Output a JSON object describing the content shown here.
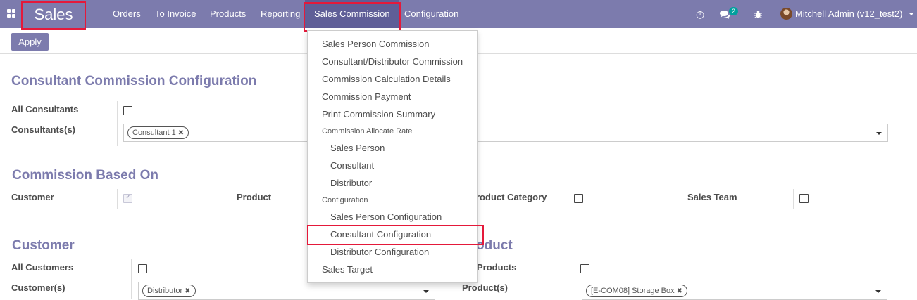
{
  "app": {
    "name": "Sales"
  },
  "topmenu": {
    "items": [
      "Orders",
      "To Invoice",
      "Products",
      "Reporting",
      "Sales Commission",
      "Configuration"
    ],
    "active": "Sales Commission"
  },
  "systray": {
    "messages_count": "2",
    "user": "Mitchell Admin (v12_test2)"
  },
  "control": {
    "apply_label": "Apply"
  },
  "consultant_section": {
    "title": "Consultant Commission Configuration",
    "all_label": "All Consultants",
    "list_label": "Consultants(s)",
    "tags": [
      "Consultant 1"
    ]
  },
  "based_on": {
    "title": "Commission Based On",
    "customer_label": "Customer",
    "customer_checked": true,
    "product_label": "Product",
    "product_category_label": "roduct Category",
    "sales_team_label": "Sales Team"
  },
  "customer_section": {
    "title": "Customer",
    "all_label": "All Customers",
    "list_label": "Customer(s)",
    "tags": [
      "Distributor"
    ]
  },
  "product_section": {
    "title": "oduct",
    "all_label": "Products",
    "list_label": "Product(s)",
    "tags": [
      "[E-COM08] Storage Box"
    ]
  },
  "dropdown": {
    "items": [
      {
        "type": "item",
        "label": "Sales Person Commission",
        "indent": false
      },
      {
        "type": "item",
        "label": "Consultant/Distributor Commission",
        "indent": false
      },
      {
        "type": "item",
        "label": "Commission Calculation Details",
        "indent": false
      },
      {
        "type": "item",
        "label": "Commission Payment",
        "indent": false
      },
      {
        "type": "item",
        "label": "Print Commission Summary",
        "indent": false
      },
      {
        "type": "header",
        "label": "Commission Allocate Rate"
      },
      {
        "type": "item",
        "label": "Sales Person",
        "indent": true
      },
      {
        "type": "item",
        "label": "Consultant",
        "indent": true
      },
      {
        "type": "item",
        "label": "Distributor",
        "indent": true
      },
      {
        "type": "header",
        "label": "Configuration"
      },
      {
        "type": "item",
        "label": "Sales Person Configuration",
        "indent": true
      },
      {
        "type": "item",
        "label": "Consultant Configuration",
        "indent": true,
        "highlighted": true
      },
      {
        "type": "item",
        "label": "Distributor Configuration",
        "indent": true
      },
      {
        "type": "item",
        "label": "Sales Target",
        "indent": false
      }
    ]
  },
  "colors": {
    "brand": "#7c7bad",
    "highlight": "#e4193a",
    "badge": "#00a09d"
  }
}
